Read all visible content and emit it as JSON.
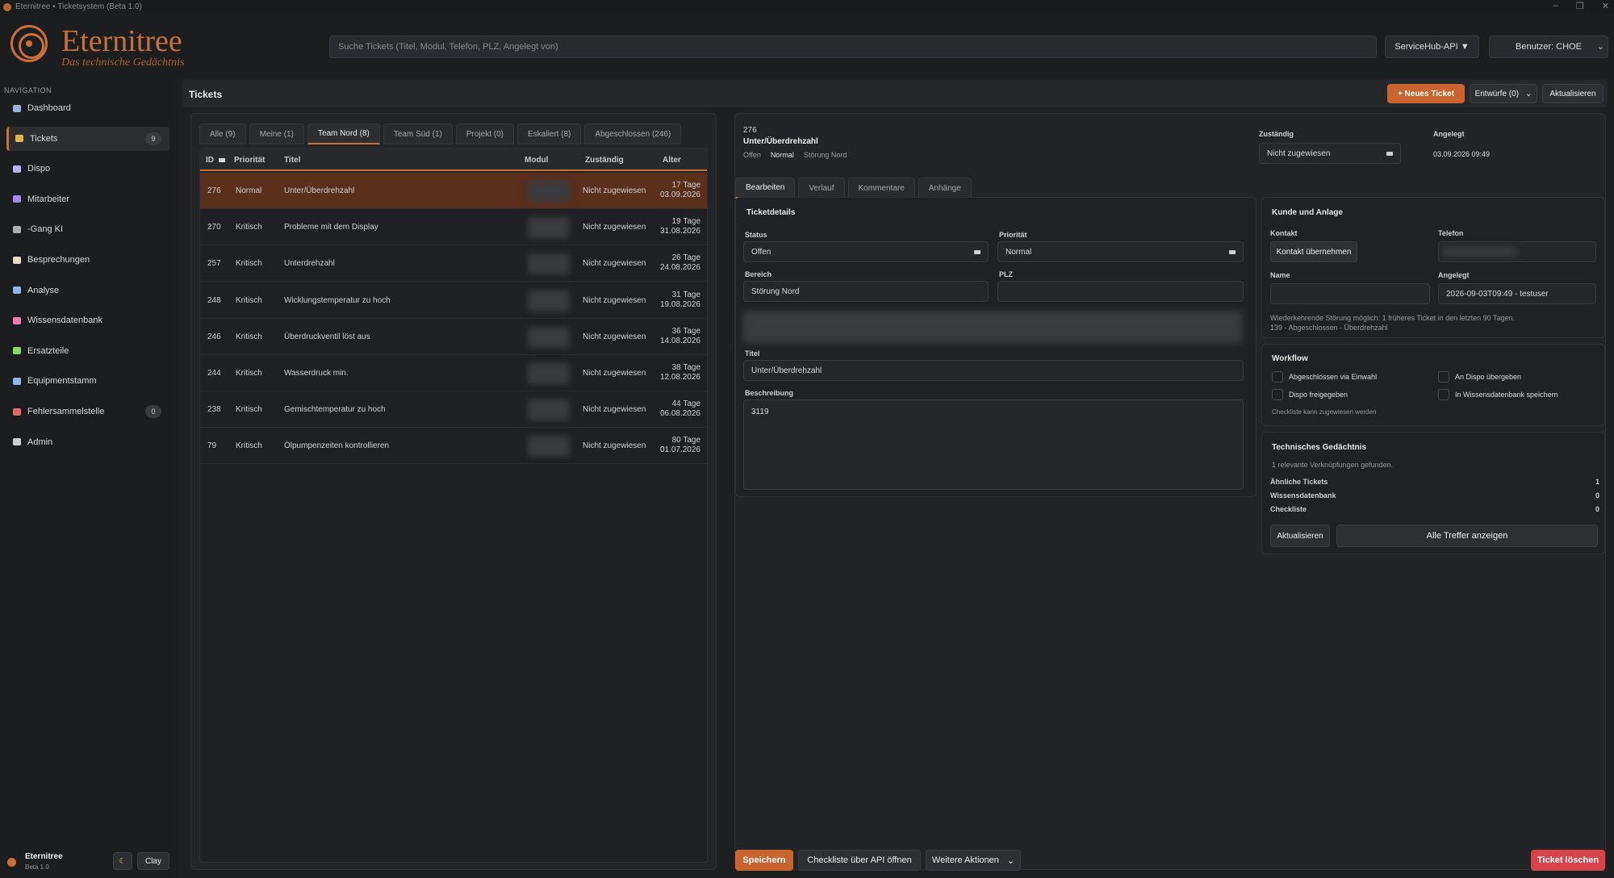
{
  "window": {
    "title": "Eternitree • Ticketsystem (Beta 1.0)",
    "minimize": "–",
    "maximize": "❐",
    "close": "✕"
  },
  "brand": {
    "name": "Eternitree",
    "tagline": "Das technische Gedächtnis"
  },
  "header": {
    "search_placeholder": "Suche Tickets (Titel, Modul, Telefon, PLZ, Angelegt von)",
    "api_button": "ServiceHub-API ▼",
    "user_button": "Benutzer: CHOE",
    "user_chevron": "⌄"
  },
  "sidebar": {
    "nav_label": "NAVIGATION",
    "items": [
      {
        "label": "Dashboard",
        "icon": "dashboard-icon",
        "color": "#9fb2d8"
      },
      {
        "label": "Tickets",
        "icon": "ticket-icon",
        "color": "#e0b84a",
        "badge": "9"
      },
      {
        "label": "Dispo",
        "icon": "calendar-icon",
        "color": "#b9b3f0"
      },
      {
        "label": "Mitarbeiter",
        "icon": "people-icon",
        "color": "#a58cf0"
      },
      {
        "label": "-Gang KI",
        "icon": "robot-icon",
        "color": "#b0b0b0"
      },
      {
        "label": "Besprechungen",
        "icon": "document-icon",
        "color": "#e9d9c0"
      },
      {
        "label": "Analyse",
        "icon": "chart-icon",
        "color": "#8fb7e8"
      },
      {
        "label": "Wissensdatenbank",
        "icon": "brain-icon",
        "color": "#f07ab2"
      },
      {
        "label": "Ersatzteile",
        "icon": "puzzle-icon",
        "color": "#8ad66a"
      },
      {
        "label": "Equipmentstamm",
        "icon": "bar-chart-icon",
        "color": "#8fb7e8"
      },
      {
        "label": "Fehlersammelstelle",
        "icon": "bug-icon",
        "color": "#e06a6a",
        "badge": "0"
      },
      {
        "label": "Admin",
        "icon": "gear-icon",
        "color": "#cfcfcf"
      }
    ],
    "footer": {
      "name": "Eternitree",
      "version": "Beta 1.0",
      "theme_icon": "☾",
      "theme_label": "Clay"
    }
  },
  "page": {
    "title": "Tickets",
    "new_ticket": "+ Neues Ticket",
    "drafts": "Entwürfe (0)",
    "drafts_chevron": "⌄",
    "refresh": "Aktualisieren"
  },
  "ticket_list": {
    "tabs": [
      "Alle (9)",
      "Meine (1)",
      "Team Nord (8)",
      "Team Süd (1)",
      "Projekt (0)",
      "Eskaliert (8)",
      "Abgeschlossen (246)"
    ],
    "active_tab": 2,
    "columns": {
      "id": "ID",
      "priority": "Priorität",
      "title": "Titel",
      "module": "Modul",
      "assignee": "Zuständig",
      "age": "Alter"
    },
    "rows": [
      {
        "id": "276",
        "priority": "Normal",
        "title": "Unter/Überdrehzahl",
        "assignee": "Nicht zugewiesen",
        "age_days": "17 Tage",
        "age_date": "03.09.2026",
        "selected": true
      },
      {
        "id": "270",
        "priority": "Kritisch",
        "title": "Probleme mit dem Display",
        "assignee": "Nicht zugewiesen",
        "age_days": "19 Tage",
        "age_date": "31.08.2026"
      },
      {
        "id": "257",
        "priority": "Kritisch",
        "title": "Unterdrehzahl",
        "assignee": "Nicht zugewiesen",
        "age_days": "26 Tage",
        "age_date": "24.08.2026"
      },
      {
        "id": "248",
        "priority": "Kritisch",
        "title": "Wicklungstemperatur zu hoch",
        "assignee": "Nicht zugewiesen",
        "age_days": "31 Tage",
        "age_date": "19.08.2026"
      },
      {
        "id": "246",
        "priority": "Kritisch",
        "title": "Überdruckventil löst aus",
        "assignee": "Nicht zugewiesen",
        "age_days": "36 Tage",
        "age_date": "14.08.2026"
      },
      {
        "id": "244",
        "priority": "Kritisch",
        "title": "Wasserdruck min.",
        "assignee": "Nicht zugewiesen",
        "age_days": "38 Tage",
        "age_date": "12.08.2026"
      },
      {
        "id": "238",
        "priority": "Kritisch",
        "title": "Gemischtemperatur zu hoch",
        "assignee": "Nicht zugewiesen",
        "age_days": "44 Tage",
        "age_date": "06.08.2026"
      },
      {
        "id": "79",
        "priority": "Kritisch",
        "title": "Ölpumpenzeiten kontrollieren",
        "assignee": "Nicht zugewiesen",
        "age_days": "80 Tage",
        "age_date": "01.07.2026"
      }
    ]
  },
  "detail": {
    "id": "276",
    "title": "Unter/Überdrehzahl",
    "chips": [
      "Offen",
      "Normal",
      "Störung Nord"
    ],
    "assignee_label": "Zuständig",
    "assignee_value": "Nicht zugewiesen",
    "created_label": "Angelegt",
    "created_value": "03.09.2026 09:49",
    "tabs": [
      "Bearbeiten",
      "Verlauf",
      "Kommentare",
      "Anhänge"
    ],
    "active_tab": 0,
    "ticketdetails": {
      "section": "Ticketdetails",
      "status_label": "Status",
      "status_value": "Offen",
      "priority_label": "Priorität",
      "priority_value": "Normal",
      "area_label": "Bereich",
      "area_value": "Störung Nord",
      "plz_label": "PLZ",
      "title_label": "Titel",
      "title_value": "Unter/Überdrehzahl",
      "desc_label": "Beschreibung",
      "desc_value": "3119"
    },
    "customer": {
      "section": "Kunde und Anlage",
      "contact_label": "Kontakt",
      "contact_button": "Kontakt übernehmen",
      "phone_label": "Telefon",
      "name_label": "Name",
      "created_label": "Angelegt",
      "created_value": "2026-09-03T09:49 - testuser",
      "note_line1": "Wiederkehrende Störung möglich: 1 früheres Ticket in den letzten 90 Tagen.",
      "note_line2": "139 - Abgeschlossen - Überdrehzahl"
    },
    "workflow": {
      "section": "Workflow",
      "items": [
        "Abgeschlossen via Einwahl",
        "An Dispo übergeben",
        "Dispo freigegeben",
        "In Wissensdatenbank speichern"
      ],
      "hint": "Checkliste kann zugewiesen werden"
    },
    "memory": {
      "section": "Technisches Gedächtnis",
      "summary": "1 relevante Verknüpfungen gefunden.",
      "stats": [
        {
          "label": "Ähnliche Tickets",
          "value": "1"
        },
        {
          "label": "Wissensdatenbank",
          "value": "0"
        },
        {
          "label": "Checkliste",
          "value": "0"
        }
      ],
      "refresh": "Aktualisieren",
      "show_all": "Alle Treffer anzeigen"
    },
    "actions": {
      "save": "Speichern",
      "checklist": "Checkliste über API öffnen",
      "more": "Weitere Aktionen",
      "more_chevron": "⌄",
      "delete": "Ticket löschen"
    }
  }
}
